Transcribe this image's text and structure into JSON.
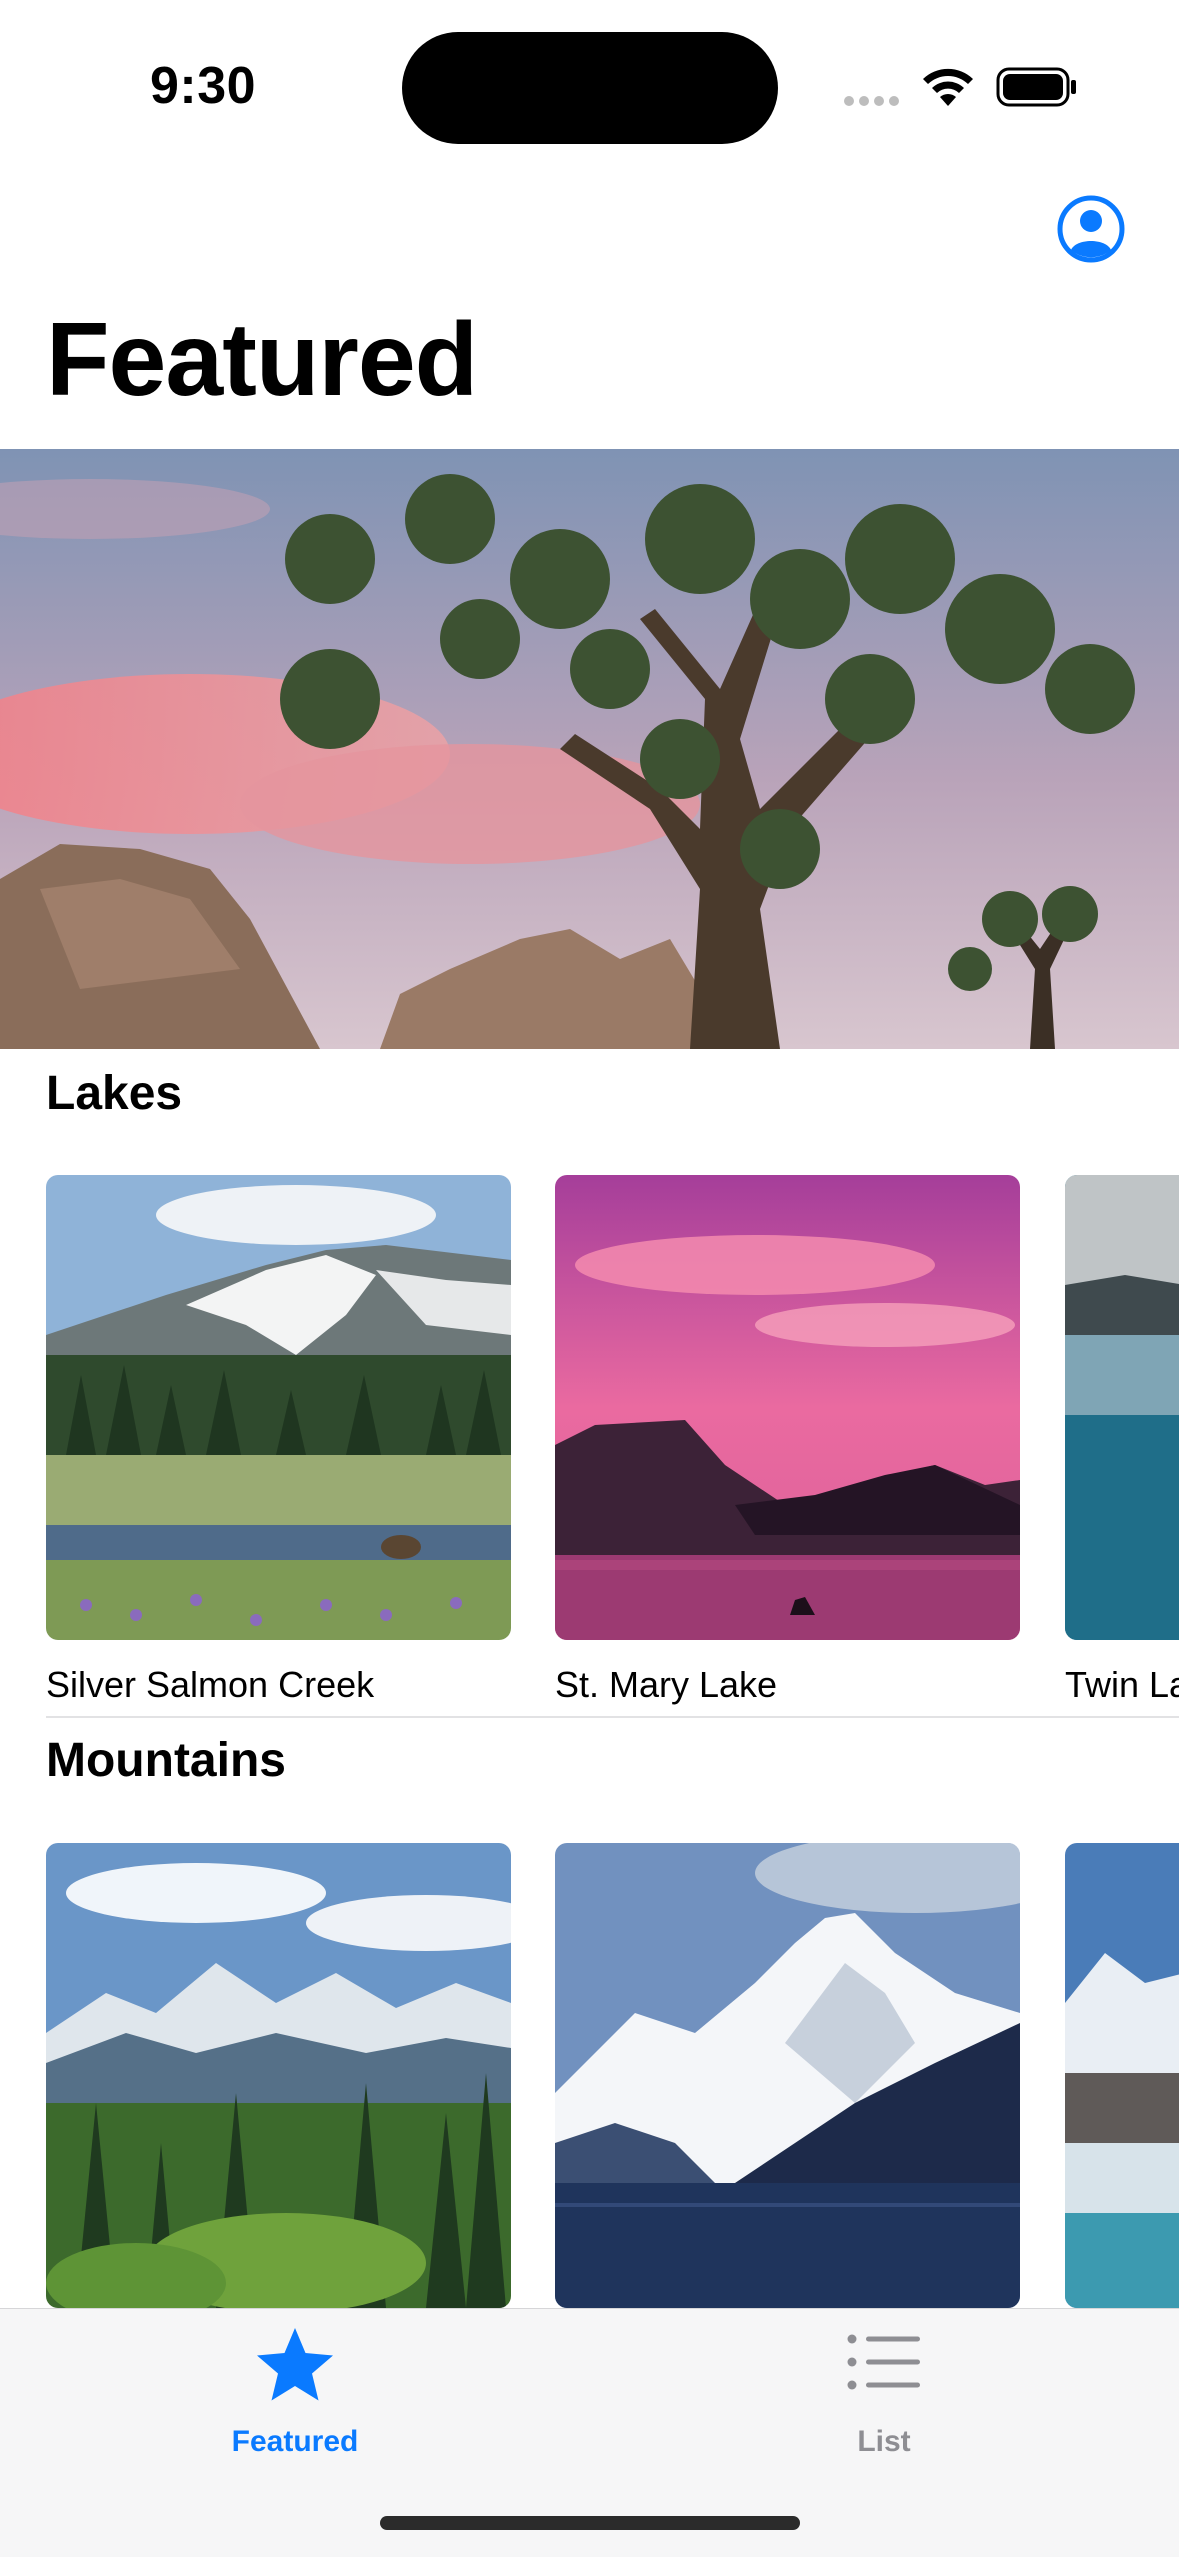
{
  "status_bar": {
    "time": "9:30"
  },
  "header": {
    "title": "Featured"
  },
  "hero": {
    "image_name": "joshua-tree-sunset-photo"
  },
  "sections": [
    {
      "title": "Lakes",
      "items": [
        {
          "name": "Silver Salmon Creek"
        },
        {
          "name": "St. Mary Lake"
        },
        {
          "name": "Twin Lake"
        }
      ]
    },
    {
      "title": "Mountains",
      "items": [
        {
          "name": ""
        },
        {
          "name": ""
        },
        {
          "name": ""
        }
      ]
    }
  ],
  "tab_bar": {
    "tabs": [
      {
        "label": "Featured",
        "icon": "star-icon",
        "selected": true
      },
      {
        "label": "List",
        "icon": "list-icon",
        "selected": false
      }
    ]
  },
  "colors": {
    "accent": "#0a7aff",
    "inactive": "#8e8e93",
    "background": "#ffffff"
  }
}
